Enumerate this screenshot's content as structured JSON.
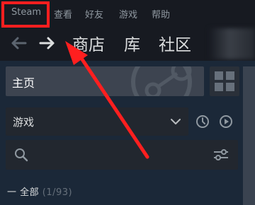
{
  "menu": {
    "steam": "Steam",
    "view": "查看",
    "friends": "好友",
    "games": "游戏",
    "help": "帮助"
  },
  "nav": {
    "store": "商店",
    "library": "库",
    "community": "社区"
  },
  "sidebar": {
    "home_label": "主页",
    "games_dropdown_value": "游戏",
    "section_label": "一 全部",
    "section_count": "(1/93)"
  },
  "colors": {
    "annotation": "#ff1f1f",
    "menubar_bg": "#171a21",
    "sidebar_bg": "#1b2838",
    "home_row_bg": "#3d4450",
    "text_light": "#dcdedf",
    "text_muted": "#8f98a0"
  },
  "icons": {
    "back": "back-arrow-icon",
    "forward": "forward-arrow-icon",
    "grid": "grid-view-icon",
    "dropdown": "chevron-down-icon",
    "recent": "clock-icon",
    "play": "play-icon",
    "search": "search-icon",
    "filter": "filter-sliders-icon"
  }
}
